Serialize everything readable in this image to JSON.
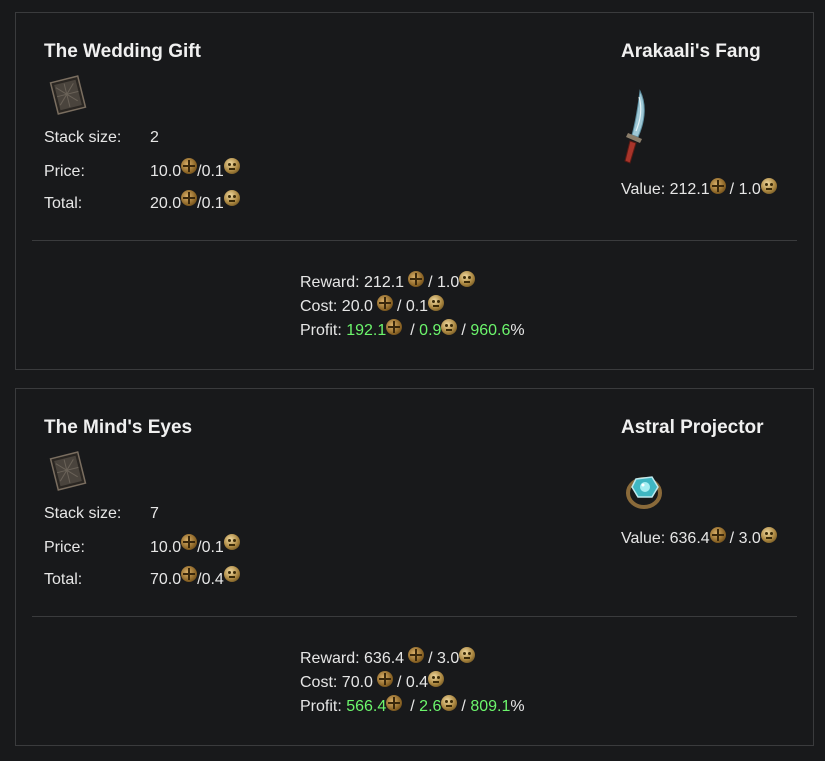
{
  "cards": [
    {
      "name": "The Wedding Gift",
      "stack_label": "Stack size:",
      "stack": "2",
      "price_label": "Price:",
      "price_chaos": "10.0",
      "price_divine": "/0.1",
      "total_label": "Total:",
      "total_chaos": "20.0",
      "total_divine": "/0.1",
      "reward_name": "Arakaali's Fang",
      "value_label": "Value: ",
      "value_chaos": "212.1",
      "value_divine": "/ 1.0",
      "summary": {
        "reward_label": "Reward: ",
        "reward_chaos": "212.1",
        "reward_divine": "/ 1.0",
        "cost_label": "Cost: ",
        "cost_chaos": "20.0",
        "cost_divine": "/ 0.1",
        "profit_label": "Profit: ",
        "profit_chaos": "192.1",
        "profit_sep1": "/ ",
        "profit_divine": "0.9",
        "profit_sep2": "/ ",
        "profit_pct": "960.6",
        "pct_sign": "%"
      }
    },
    {
      "name": "The Mind's Eyes",
      "stack_label": "Stack size:",
      "stack": "7",
      "price_label": "Price:",
      "price_chaos": "10.0",
      "price_divine": "/0.1",
      "total_label": "Total:",
      "total_chaos": "70.0",
      "total_divine": "/0.4",
      "reward_name": "Astral Projector",
      "value_label": "Value: ",
      "value_chaos": "636.4",
      "value_divine": "/ 3.0",
      "summary": {
        "reward_label": "Reward: ",
        "reward_chaos": "636.4",
        "reward_divine": "/ 3.0",
        "cost_label": "Cost: ",
        "cost_chaos": "70.0",
        "cost_divine": "/ 0.4",
        "profit_label": "Profit: ",
        "profit_chaos": "566.4",
        "profit_sep1": "/ ",
        "profit_divine": "2.6",
        "profit_sep2": "/ ",
        "profit_pct": "809.1",
        "pct_sign": "%"
      }
    }
  ],
  "colors": {
    "background": "#18191b",
    "border": "#3a3b3d",
    "profit_green": "#6cf56c"
  },
  "icons": {
    "divination_card": "divination-card-icon",
    "chaos_orb": "chaos-orb-icon",
    "divine_orb": "divine-orb-icon",
    "dagger": "dagger-icon",
    "ring": "ring-icon"
  }
}
